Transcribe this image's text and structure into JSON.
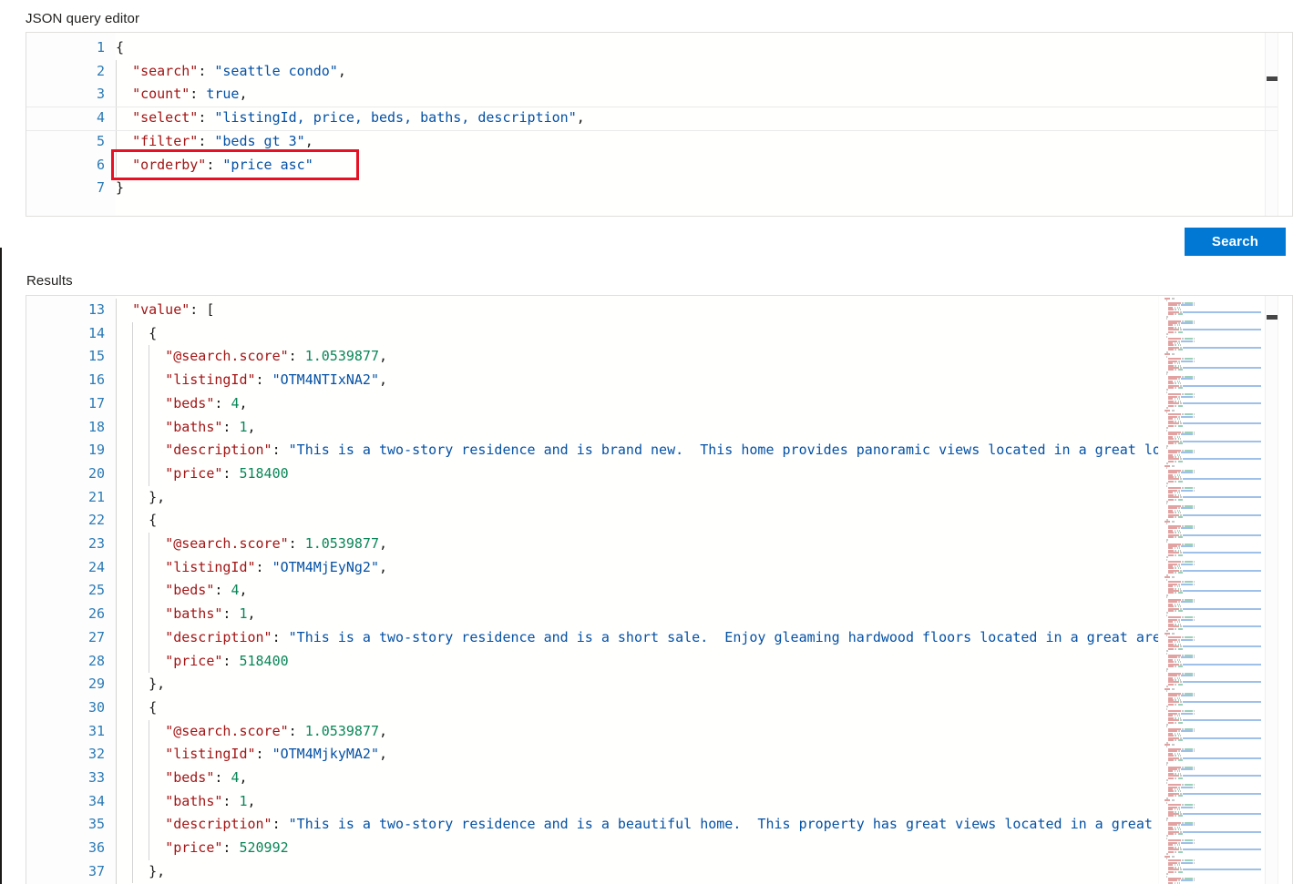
{
  "editor": {
    "label": "JSON query editor",
    "lines": [
      {
        "n": "1",
        "indent": 0,
        "tokens": [
          {
            "t": "{",
            "c": "punc"
          }
        ]
      },
      {
        "n": "2",
        "indent": 1,
        "tokens": [
          {
            "t": "\"search\"",
            "c": "key"
          },
          {
            "t": ": ",
            "c": "punc"
          },
          {
            "t": "\"seattle condo\"",
            "c": "str"
          },
          {
            "t": ",",
            "c": "punc"
          }
        ]
      },
      {
        "n": "3",
        "indent": 1,
        "tokens": [
          {
            "t": "\"count\"",
            "c": "key"
          },
          {
            "t": ": ",
            "c": "punc"
          },
          {
            "t": "true",
            "c": "bool"
          },
          {
            "t": ",",
            "c": "punc"
          }
        ]
      },
      {
        "n": "4",
        "indent": 1,
        "tokens": [
          {
            "t": "\"select\"",
            "c": "key"
          },
          {
            "t": ": ",
            "c": "punc"
          },
          {
            "t": "\"listingId, price, beds, baths, description\"",
            "c": "str"
          },
          {
            "t": ",",
            "c": "punc"
          }
        ]
      },
      {
        "n": "5",
        "indent": 1,
        "tokens": [
          {
            "t": "\"filter\"",
            "c": "key"
          },
          {
            "t": ": ",
            "c": "punc"
          },
          {
            "t": "\"beds gt 3\"",
            "c": "str"
          },
          {
            "t": ",",
            "c": "punc"
          }
        ]
      },
      {
        "n": "6",
        "indent": 1,
        "tokens": [
          {
            "t": "\"orderby\"",
            "c": "key"
          },
          {
            "t": ": ",
            "c": "punc"
          },
          {
            "t": "\"price asc\"",
            "c": "str"
          }
        ]
      },
      {
        "n": "7",
        "indent": 0,
        "tokens": [
          {
            "t": "}",
            "c": "punc"
          }
        ]
      }
    ],
    "current_line": 4,
    "highlight": {
      "target_line": 6,
      "color": "#e81123"
    }
  },
  "actions": {
    "search_label": "Search",
    "search_color": "#0078d4"
  },
  "results": {
    "label": "Results",
    "lines": [
      {
        "n": "13",
        "indent": 1,
        "tokens": [
          {
            "t": "\"value\"",
            "c": "key"
          },
          {
            "t": ": [",
            "c": "punc"
          }
        ]
      },
      {
        "n": "14",
        "indent": 2,
        "tokens": [
          {
            "t": "{",
            "c": "punc"
          }
        ]
      },
      {
        "n": "15",
        "indent": 3,
        "tokens": [
          {
            "t": "\"@search.score\"",
            "c": "key"
          },
          {
            "t": ": ",
            "c": "punc"
          },
          {
            "t": "1.0539877",
            "c": "num"
          },
          {
            "t": ",",
            "c": "punc"
          }
        ]
      },
      {
        "n": "16",
        "indent": 3,
        "tokens": [
          {
            "t": "\"listingId\"",
            "c": "key"
          },
          {
            "t": ": ",
            "c": "punc"
          },
          {
            "t": "\"OTM4NTIxNA2\"",
            "c": "str"
          },
          {
            "t": ",",
            "c": "punc"
          }
        ]
      },
      {
        "n": "17",
        "indent": 3,
        "tokens": [
          {
            "t": "\"beds\"",
            "c": "key"
          },
          {
            "t": ": ",
            "c": "punc"
          },
          {
            "t": "4",
            "c": "num"
          },
          {
            "t": ",",
            "c": "punc"
          }
        ]
      },
      {
        "n": "18",
        "indent": 3,
        "tokens": [
          {
            "t": "\"baths\"",
            "c": "key"
          },
          {
            "t": ": ",
            "c": "punc"
          },
          {
            "t": "1",
            "c": "num"
          },
          {
            "t": ",",
            "c": "punc"
          }
        ]
      },
      {
        "n": "19",
        "indent": 3,
        "tokens": [
          {
            "t": "\"description\"",
            "c": "key"
          },
          {
            "t": ": ",
            "c": "punc"
          },
          {
            "t": "\"This is a two-story residence and is brand new.  This home provides panoramic views located in a great location",
            "c": "str"
          }
        ]
      },
      {
        "n": "20",
        "indent": 3,
        "tokens": [
          {
            "t": "\"price\"",
            "c": "key"
          },
          {
            "t": ": ",
            "c": "punc"
          },
          {
            "t": "518400",
            "c": "num"
          }
        ]
      },
      {
        "n": "21",
        "indent": 2,
        "tokens": [
          {
            "t": "},",
            "c": "punc"
          }
        ]
      },
      {
        "n": "22",
        "indent": 2,
        "tokens": [
          {
            "t": "{",
            "c": "punc"
          }
        ]
      },
      {
        "n": "23",
        "indent": 3,
        "tokens": [
          {
            "t": "\"@search.score\"",
            "c": "key"
          },
          {
            "t": ": ",
            "c": "punc"
          },
          {
            "t": "1.0539877",
            "c": "num"
          },
          {
            "t": ",",
            "c": "punc"
          }
        ]
      },
      {
        "n": "24",
        "indent": 3,
        "tokens": [
          {
            "t": "\"listingId\"",
            "c": "key"
          },
          {
            "t": ": ",
            "c": "punc"
          },
          {
            "t": "\"OTM4MjEyNg2\"",
            "c": "str"
          },
          {
            "t": ",",
            "c": "punc"
          }
        ]
      },
      {
        "n": "25",
        "indent": 3,
        "tokens": [
          {
            "t": "\"beds\"",
            "c": "key"
          },
          {
            "t": ": ",
            "c": "punc"
          },
          {
            "t": "4",
            "c": "num"
          },
          {
            "t": ",",
            "c": "punc"
          }
        ]
      },
      {
        "n": "26",
        "indent": 3,
        "tokens": [
          {
            "t": "\"baths\"",
            "c": "key"
          },
          {
            "t": ": ",
            "c": "punc"
          },
          {
            "t": "1",
            "c": "num"
          },
          {
            "t": ",",
            "c": "punc"
          }
        ]
      },
      {
        "n": "27",
        "indent": 3,
        "tokens": [
          {
            "t": "\"description\"",
            "c": "key"
          },
          {
            "t": ": ",
            "c": "punc"
          },
          {
            "t": "\"This is a two-story residence and is a short sale.  Enjoy gleaming hardwood floors located in a great area",
            "c": "str"
          }
        ]
      },
      {
        "n": "28",
        "indent": 3,
        "tokens": [
          {
            "t": "\"price\"",
            "c": "key"
          },
          {
            "t": ": ",
            "c": "punc"
          },
          {
            "t": "518400",
            "c": "num"
          }
        ]
      },
      {
        "n": "29",
        "indent": 2,
        "tokens": [
          {
            "t": "},",
            "c": "punc"
          }
        ]
      },
      {
        "n": "30",
        "indent": 2,
        "tokens": [
          {
            "t": "{",
            "c": "punc"
          }
        ]
      },
      {
        "n": "31",
        "indent": 3,
        "tokens": [
          {
            "t": "\"@search.score\"",
            "c": "key"
          },
          {
            "t": ": ",
            "c": "punc"
          },
          {
            "t": "1.0539877",
            "c": "num"
          },
          {
            "t": ",",
            "c": "punc"
          }
        ]
      },
      {
        "n": "32",
        "indent": 3,
        "tokens": [
          {
            "t": "\"listingId\"",
            "c": "key"
          },
          {
            "t": ": ",
            "c": "punc"
          },
          {
            "t": "\"OTM4MjkyMA2\"",
            "c": "str"
          },
          {
            "t": ",",
            "c": "punc"
          }
        ]
      },
      {
        "n": "33",
        "indent": 3,
        "tokens": [
          {
            "t": "\"beds\"",
            "c": "key"
          },
          {
            "t": ": ",
            "c": "punc"
          },
          {
            "t": "4",
            "c": "num"
          },
          {
            "t": ",",
            "c": "punc"
          }
        ]
      },
      {
        "n": "34",
        "indent": 3,
        "tokens": [
          {
            "t": "\"baths\"",
            "c": "key"
          },
          {
            "t": ": ",
            "c": "punc"
          },
          {
            "t": "1",
            "c": "num"
          },
          {
            "t": ",",
            "c": "punc"
          }
        ]
      },
      {
        "n": "35",
        "indent": 3,
        "tokens": [
          {
            "t": "\"description\"",
            "c": "key"
          },
          {
            "t": ": ",
            "c": "punc"
          },
          {
            "t": "\"This is a two-story residence and is a beautiful home.  This property has great views located in a great",
            "c": "str"
          }
        ]
      },
      {
        "n": "36",
        "indent": 3,
        "tokens": [
          {
            "t": "\"price\"",
            "c": "key"
          },
          {
            "t": ": ",
            "c": "punc"
          },
          {
            "t": "520992",
            "c": "num"
          }
        ]
      },
      {
        "n": "37",
        "indent": 2,
        "tokens": [
          {
            "t": "},",
            "c": "punc"
          }
        ]
      }
    ]
  }
}
